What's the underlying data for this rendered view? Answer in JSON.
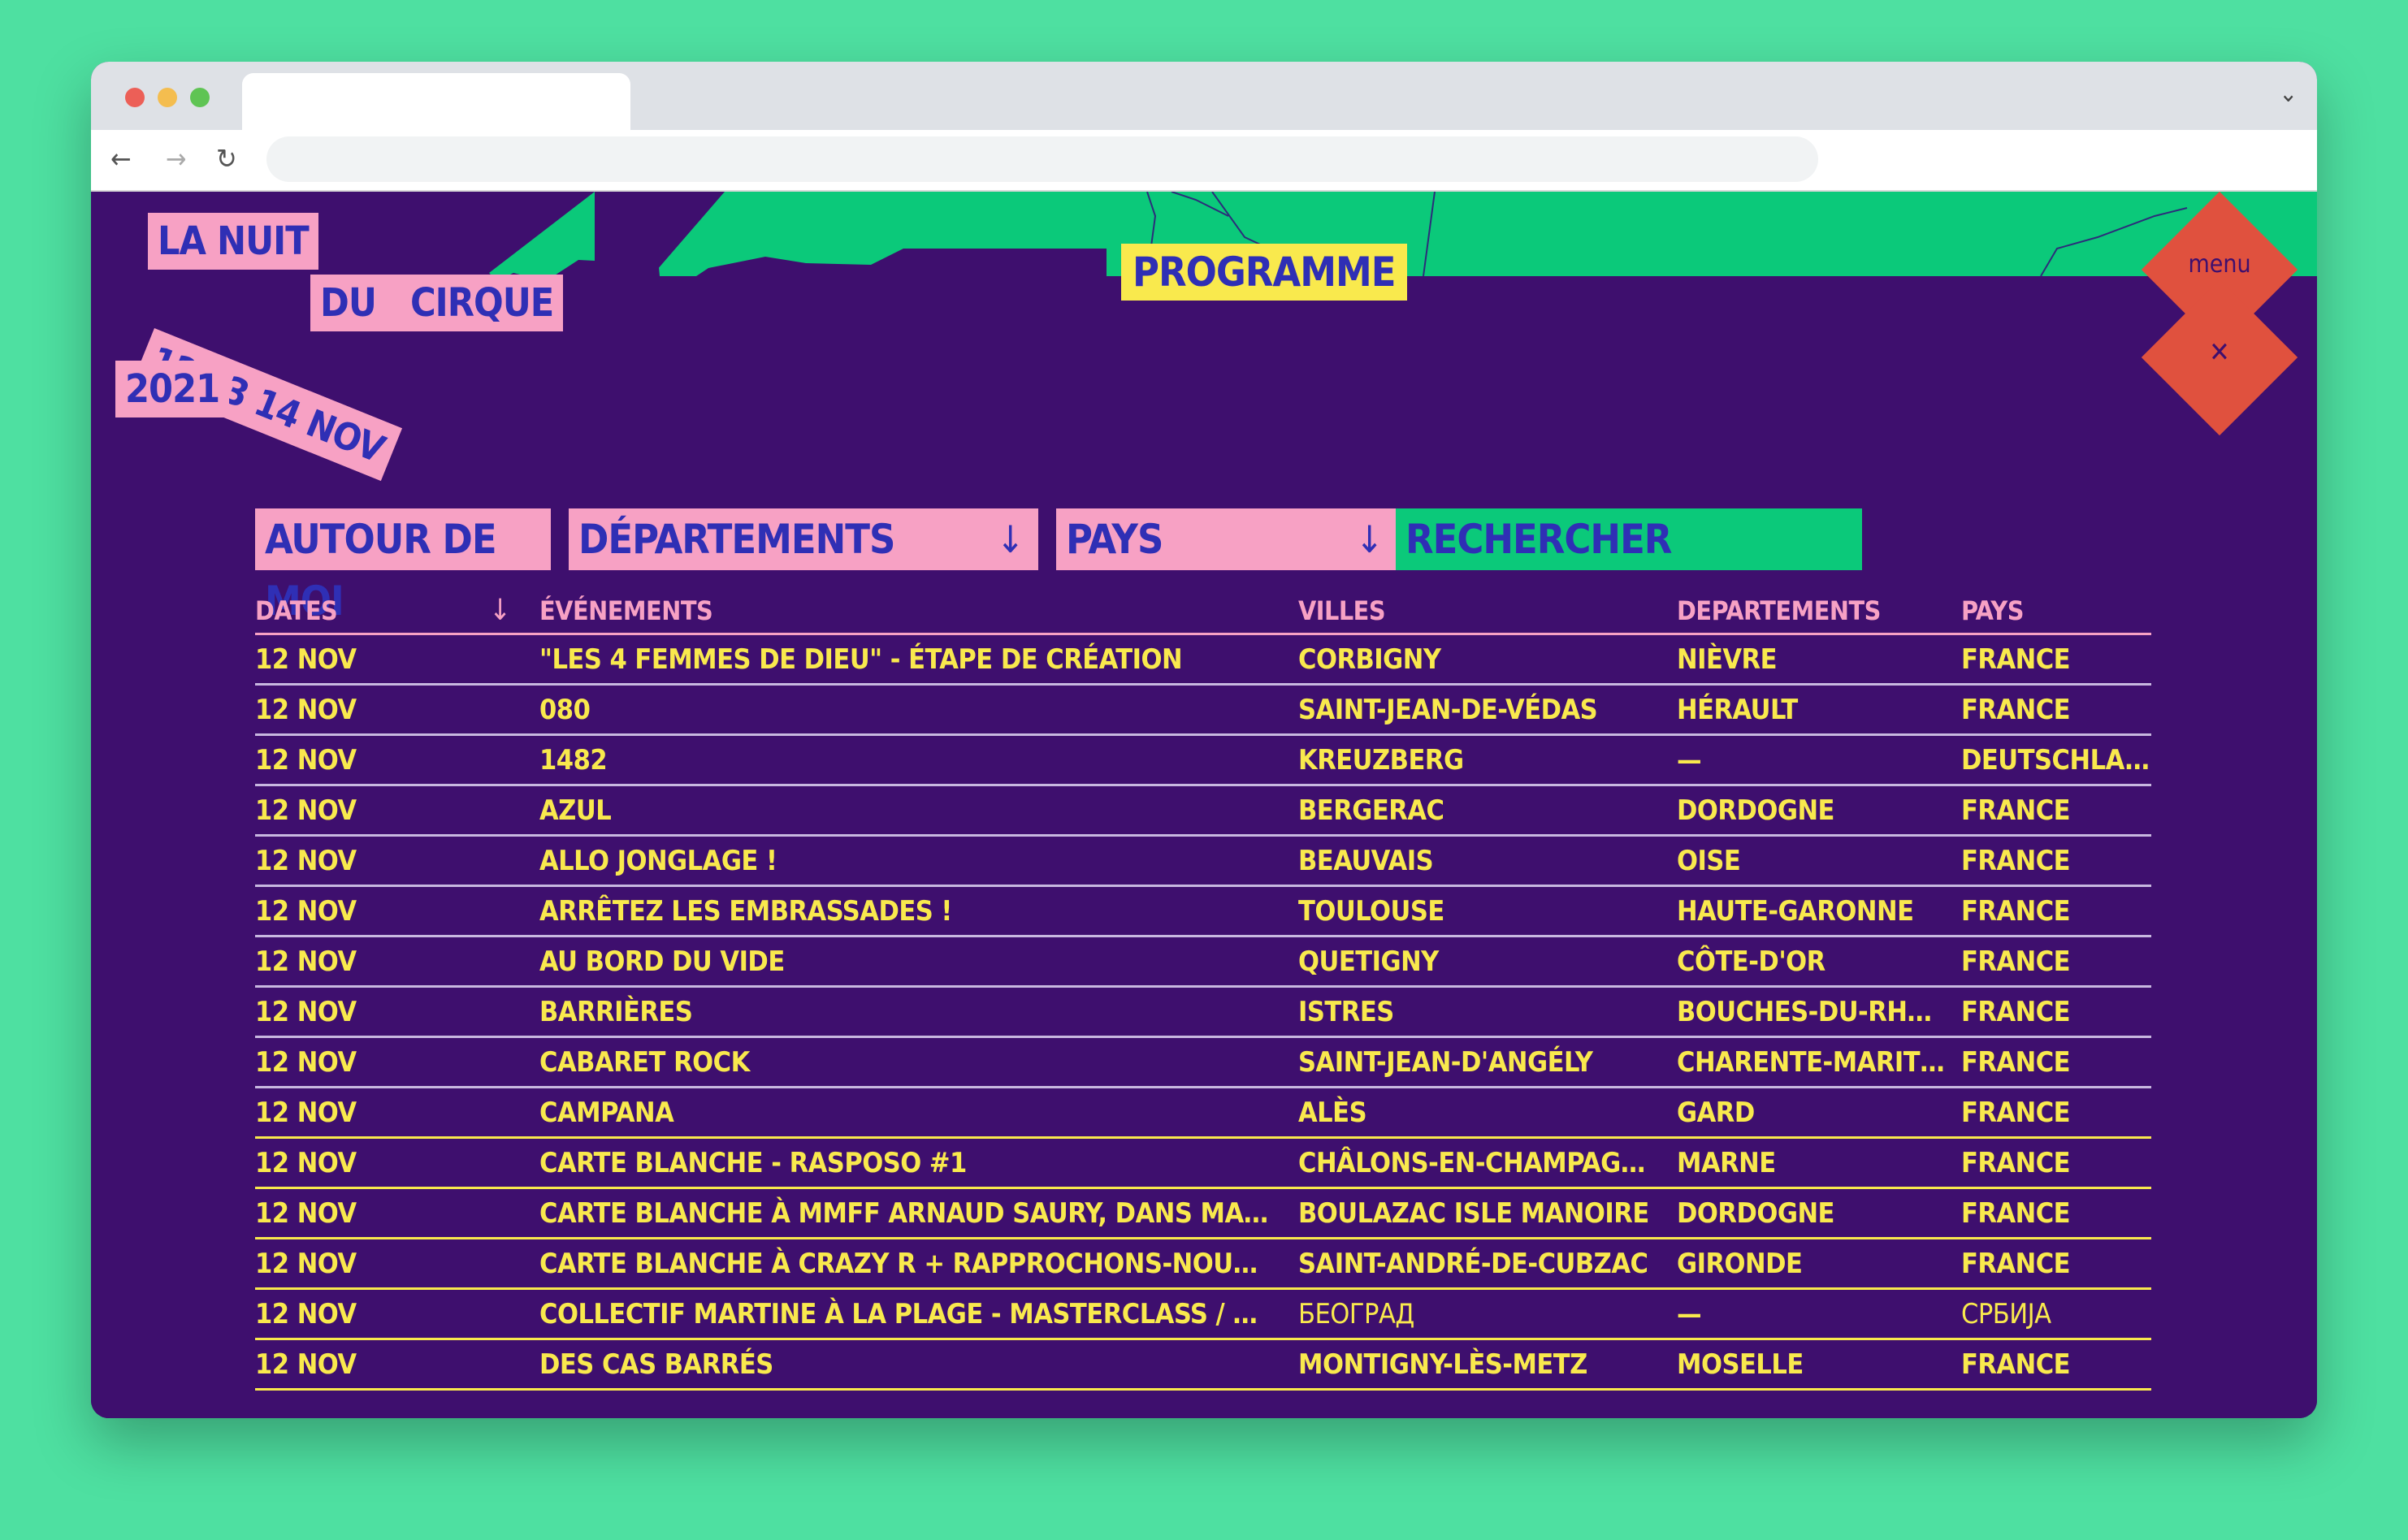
{
  "browser": {
    "traffic_lights": [
      "#ec5f57",
      "#f4bd4f",
      "#5fc454"
    ],
    "chevron_icon": "chevron-down-icon",
    "nav_icons": [
      "back-arrow-icon",
      "forward-arrow-icon",
      "reload-icon"
    ]
  },
  "logo": {
    "line1": "LA NUIT",
    "line2": "DU   CIRQUE",
    "dates": "12 13 14 NOV",
    "year": "2021"
  },
  "header": {
    "programme": "PROGRAMME"
  },
  "menu": {
    "menu_label": "menu",
    "close_label": "✕"
  },
  "filters": {
    "around_me": "AUTOUR DE MOI",
    "departments": "DÉPARTEMENTS",
    "country": "PAYS",
    "search": "RECHERCHER",
    "arrow": "↓"
  },
  "table": {
    "headers": {
      "dates": "DATES",
      "events": "ÉVÉNEMENTS",
      "cities": "VILLES",
      "departments": "DEPARTEMENTS",
      "country": "PAYS",
      "sort": "↓"
    },
    "rows": [
      {
        "date": "12 NOV",
        "event": "\"LES 4 FEMMES DE DIEU\" - ÉTAPE DE CRÉATION",
        "city": "CORBIGNY",
        "dept": "NIÈVRE",
        "country": "FRANCE"
      },
      {
        "date": "12 NOV",
        "event": "080",
        "city": "SAINT-JEAN-DE-VÉDAS",
        "dept": "HÉRAULT",
        "country": "FRANCE"
      },
      {
        "date": "12 NOV",
        "event": "1482",
        "city": "KREUZBERG",
        "dept": "—",
        "country": "DEUTSCHLA..."
      },
      {
        "date": "12 NOV",
        "event": "AZUL",
        "city": "BERGERAC",
        "dept": "DORDOGNE",
        "country": "FRANCE"
      },
      {
        "date": "12 NOV",
        "event": "ALLO JONGLAGE !",
        "city": "BEAUVAIS",
        "dept": "OISE",
        "country": "FRANCE"
      },
      {
        "date": "12 NOV",
        "event": "ARRÊTEZ LES EMBRASSADES !",
        "city": "TOULOUSE",
        "dept": "HAUTE-GARONNE",
        "country": "FRANCE"
      },
      {
        "date": "12 NOV",
        "event": "AU BORD DU VIDE",
        "city": "QUETIGNY",
        "dept": "CÔTE-D'OR",
        "country": "FRANCE"
      },
      {
        "date": "12 NOV",
        "event": "BARRIÈRES",
        "city": "ISTRES",
        "dept": "BOUCHES-DU-RHÔNE",
        "country": "FRANCE"
      },
      {
        "date": "12 NOV",
        "event": "CABARET ROCK",
        "city": "SAINT-JEAN-D'ANGÉLY",
        "dept": "CHARENTE-MARITIME",
        "country": "FRANCE"
      },
      {
        "date": "12 NOV",
        "event": "CAMPANA",
        "city": "ALÈS",
        "dept": "GARD",
        "country": "FRANCE"
      },
      {
        "date": "12 NOV",
        "event": "CARTE BLANCHE - RASPOSO #1",
        "city": "CHÂLONS-EN-CHAMPAGNE",
        "dept": "MARNE",
        "country": "FRANCE"
      },
      {
        "date": "12 NOV",
        "event": "CARTE BLANCHE À MMFF ARNAUD SAURY, DANS MA CHAMBRE -...",
        "city": "BOULAZAC ISLE MANOIRE",
        "dept": "DORDOGNE",
        "country": "FRANCE"
      },
      {
        "date": "12 NOV",
        "event": "CARTE BLANCHE À CRAZY R + RAPPROCHONS-NOUS PAR LA M...",
        "city": "SAINT-ANDRÉ-DE-CUBZAC",
        "dept": "GIRONDE",
        "country": "FRANCE"
      },
      {
        "date": "12 NOV",
        "event": "COLLECTIF MARTINE À LA PLAGE - MASTERCLASS / BELGRADE",
        "city": "БЕОГРАД",
        "dept": "—",
        "country": "СРБИЈА"
      },
      {
        "date": "12 NOV",
        "event": "DES CAS BARRÉS",
        "city": "MONTIGNY-LÈS-METZ",
        "dept": "MOSELLE",
        "country": "FRANCE"
      }
    ]
  }
}
